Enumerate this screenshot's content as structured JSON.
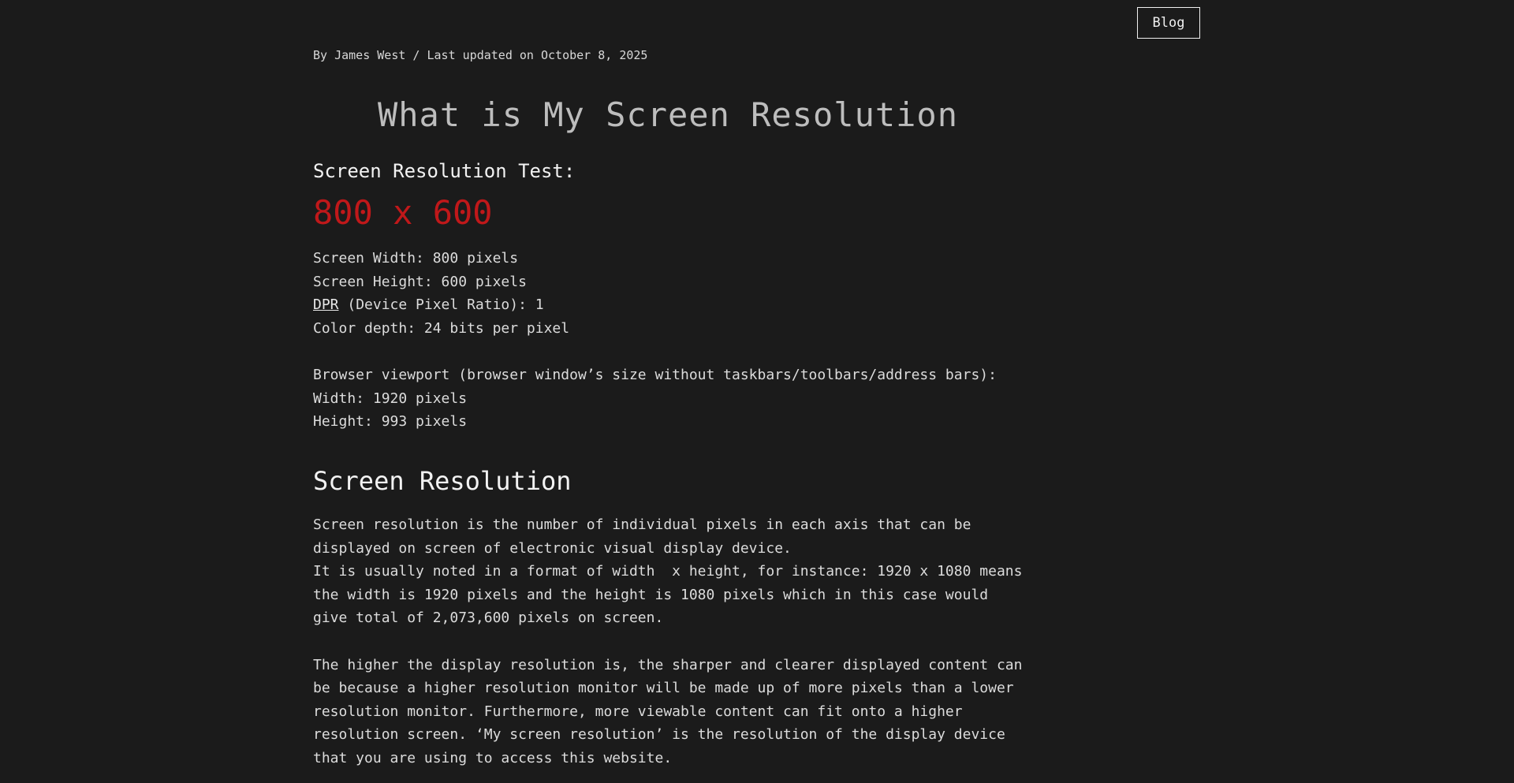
{
  "header": {
    "blog_label": "Blog"
  },
  "article": {
    "byline": "By James West / Last updated on October 8, 2025",
    "title": "What is My Screen Resolution",
    "test_heading": "Screen Resolution Test:",
    "resolution_value": "800 x 600",
    "info": {
      "screen_width": "Screen Width: 800 pixels",
      "screen_height": "Screen Height: 600 pixels",
      "dpr_link": "DPR",
      "dpr_rest": " (Device Pixel Ratio): 1",
      "color_depth": "Color depth: 24 bits per pixel",
      "viewport_label": "Browser viewport (browser window’s size without taskbars/toolbars/address bars):",
      "viewport_width": "Width: 1920 pixels",
      "viewport_height": "Height: 993 pixels"
    },
    "section_heading": "Screen Resolution",
    "paragraph1_lines": [
      "Screen resolution is the number of individual pixels in each axis that can be",
      "displayed on screen of electronic visual display device.",
      "It is usually noted in a format of width  x height, for instance: 1920 x 1080 means",
      "the width is 1920 pixels and the height is 1080 pixels which in this case would",
      "give total of 2,073,600 pixels on screen."
    ],
    "paragraph2_lines": [
      "The higher the display resolution is, the sharper and clearer displayed content can",
      "be because a higher resolution monitor will be made up of more pixels than a lower",
      "resolution monitor. Furthermore, more viewable content can fit onto a higher",
      "resolution screen. ‘My screen resolution’ is the resolution of the display device",
      "that you are using to access this website."
    ]
  },
  "colors": {
    "background": "#1b1b1b",
    "text": "#dcdcdc",
    "accent_red": "#c0181a"
  }
}
